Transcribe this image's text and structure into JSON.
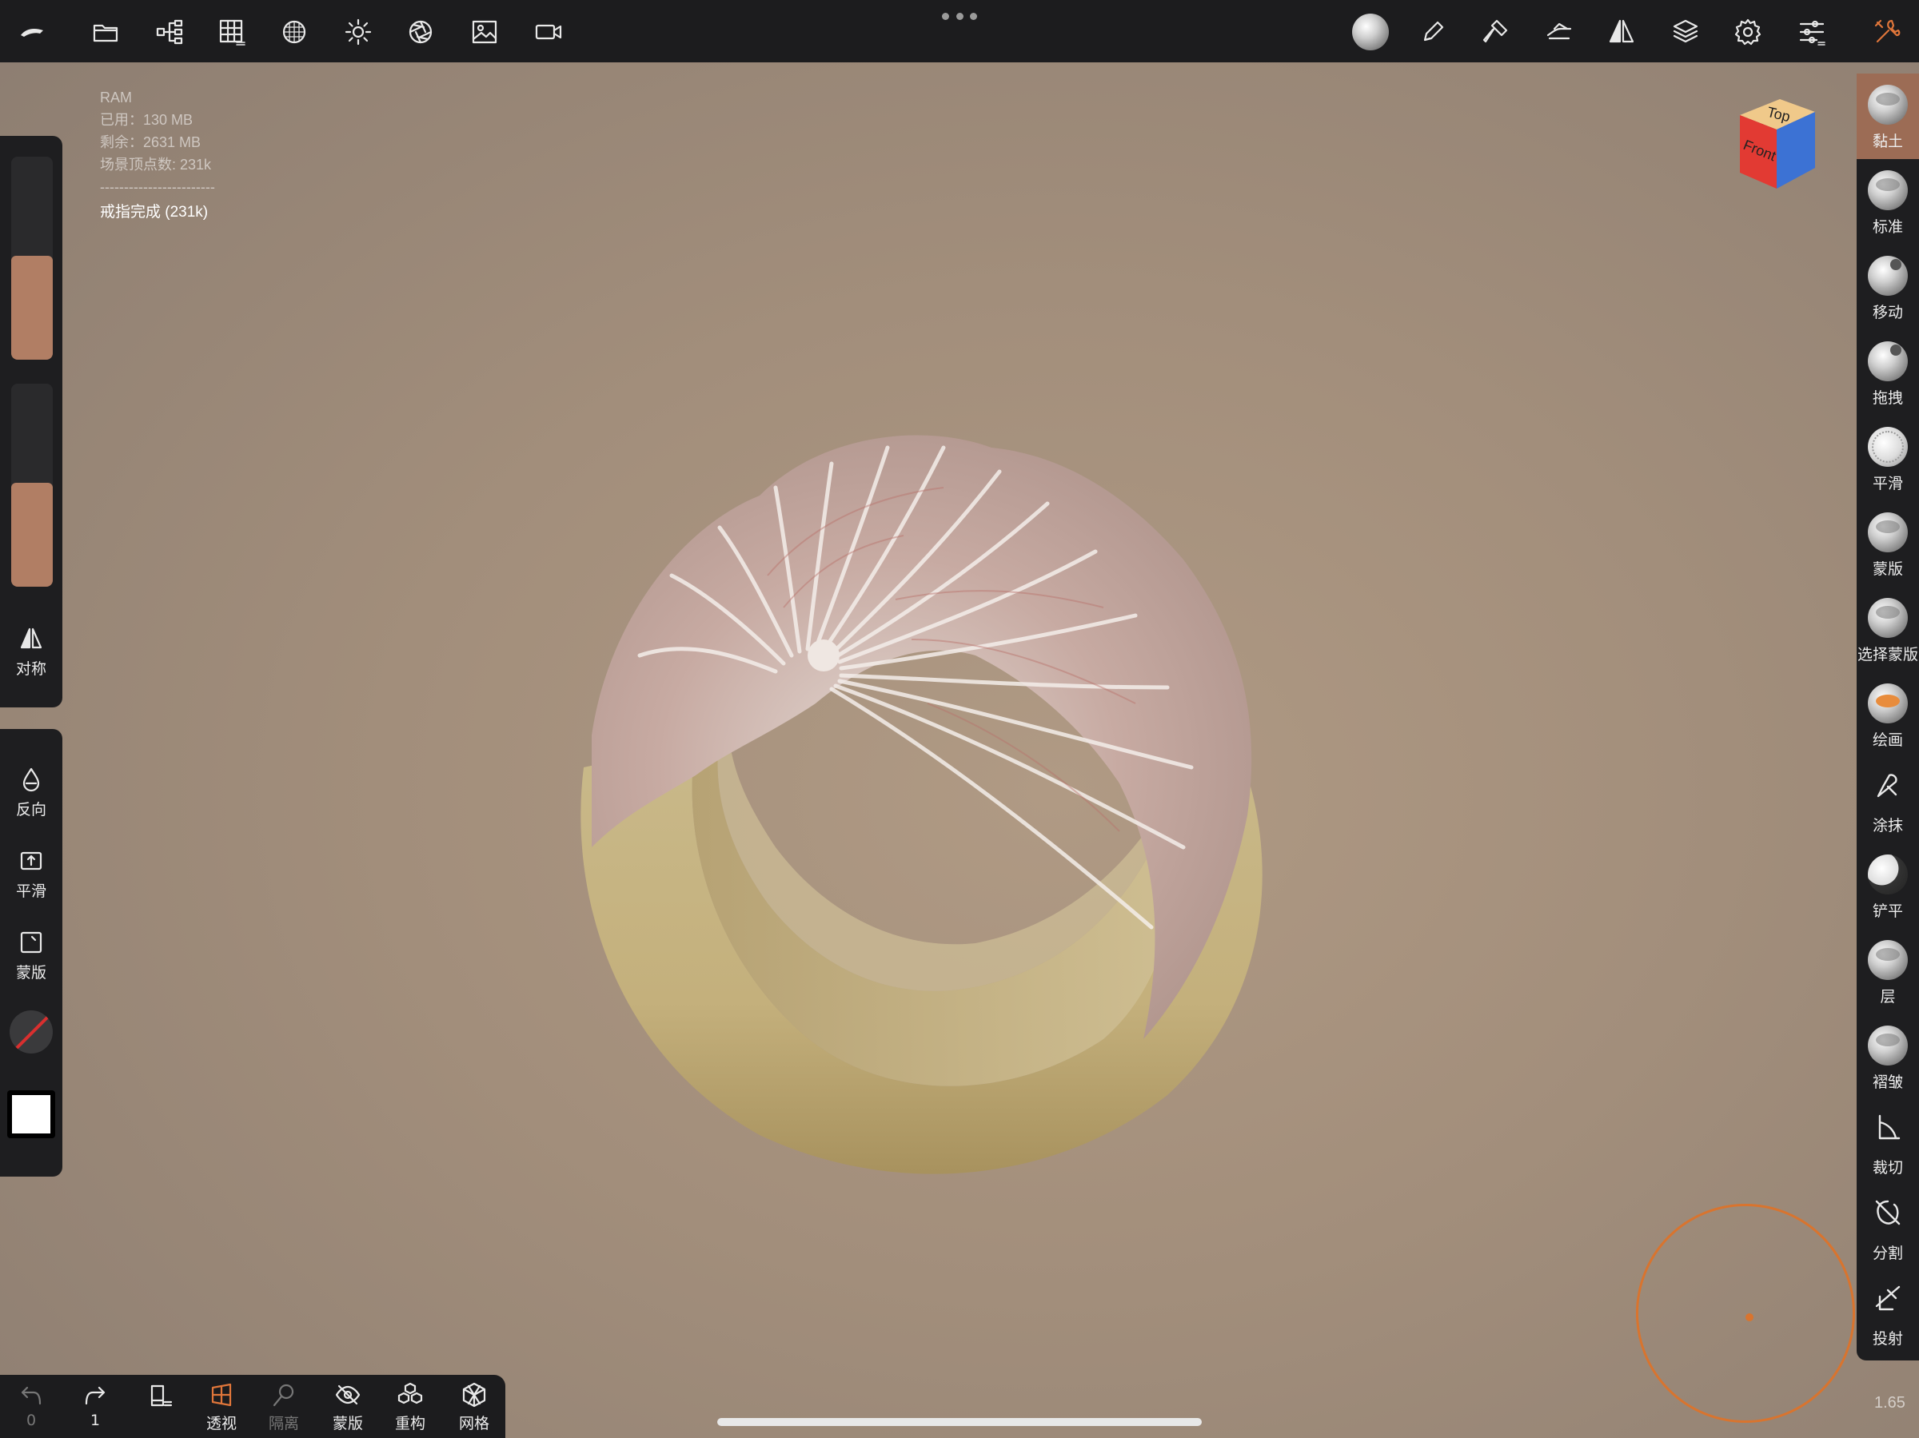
{
  "ram": {
    "title": "RAM",
    "used": "已用：130 MB",
    "free": "剩余：2631 MB",
    "vertices": "场景顶点数: 231k",
    "separator": "------------------------",
    "mesh": "戒指完成 (231k)"
  },
  "left_panel": {
    "symmetry_label": "对称",
    "radius_level": 0.51,
    "intensity_level": 0.51
  },
  "left_panel2": {
    "invert_label": "反向",
    "smooth_label": "平滑",
    "mask_label": "蒙版"
  },
  "brushes": [
    {
      "label": "黏土",
      "icon": "clay-brush-icon",
      "active": true
    },
    {
      "label": "标准",
      "icon": "standard-brush-icon"
    },
    {
      "label": "移动",
      "icon": "move-brush-icon"
    },
    {
      "label": "拖拽",
      "icon": "drag-brush-icon"
    },
    {
      "label": "平滑",
      "icon": "smooth-brush-icon"
    },
    {
      "label": "蒙版",
      "icon": "mask-brush-icon"
    },
    {
      "label": "选择蒙版",
      "icon": "select-mask-brush-icon"
    },
    {
      "label": "绘画",
      "icon": "paint-brush-icon"
    },
    {
      "label": "涂抹",
      "icon": "smudge-brush-icon"
    },
    {
      "label": "铲平",
      "icon": "flatten-brush-icon"
    },
    {
      "label": "层",
      "icon": "layer-brush-icon"
    },
    {
      "label": "褶皱",
      "icon": "crease-brush-icon"
    },
    {
      "label": "裁切",
      "icon": "trim-brush-icon"
    },
    {
      "label": "分割",
      "icon": "split-brush-icon"
    },
    {
      "label": "投射",
      "icon": "project-brush-icon"
    }
  ],
  "viewcube": {
    "top": "Top",
    "front": "Front"
  },
  "bottom": {
    "undo_count": "0",
    "redo_count": "1",
    "perspective": "透视",
    "isolate": "隔离",
    "mask": "蒙版",
    "remesh": "重构",
    "wireframe": "网格"
  },
  "zoom": "1.65",
  "colors": {
    "accent": "#d9742e",
    "slider": "#b17e64",
    "active_brush": "#9c6c55"
  }
}
